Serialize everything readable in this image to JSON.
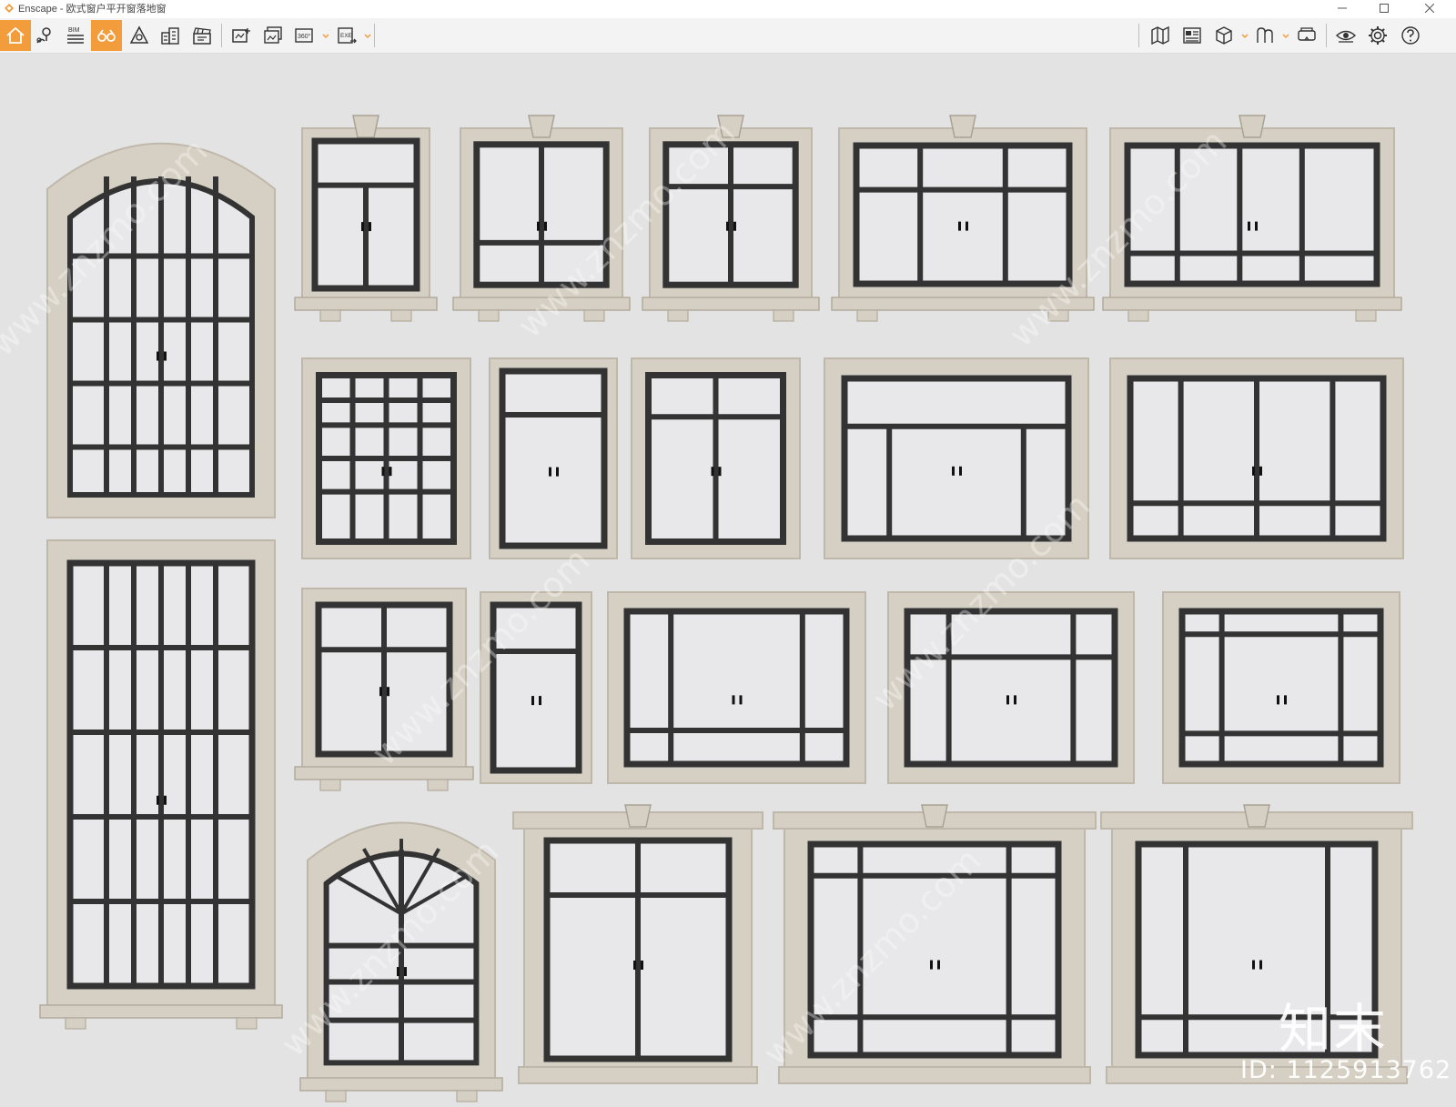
{
  "window": {
    "app_name": "Enscape",
    "separator": " - ",
    "document_name": "欧式窗户平开窗落地窗"
  },
  "toolbar": {
    "left_tools": [
      {
        "name": "home-icon",
        "active": true
      },
      {
        "name": "location-pin-icon",
        "active": false
      },
      {
        "name": "bim-icon",
        "label": "BIM",
        "active": false
      },
      {
        "name": "binoculars-icon",
        "active": true
      },
      {
        "name": "light-view-icon",
        "active": false
      },
      {
        "name": "buildings-icon",
        "active": false
      },
      {
        "name": "clapperboard-icon",
        "active": false
      },
      {
        "name": "screenshot-icon",
        "active": false
      },
      {
        "name": "batch-render-icon",
        "active": false
      },
      {
        "name": "panorama-360-icon",
        "label": "360°",
        "active": false
      },
      {
        "name": "export-exe-icon",
        "label": "EXE",
        "active": false
      }
    ],
    "right_tools": [
      {
        "name": "map-icon"
      },
      {
        "name": "asset-library-icon"
      },
      {
        "name": "cube-view-icon"
      },
      {
        "name": "material-icon"
      },
      {
        "name": "vr-headset-icon"
      },
      {
        "name": "visual-settings-icon"
      },
      {
        "name": "settings-gear-icon"
      },
      {
        "name": "help-icon"
      }
    ]
  },
  "watermark": {
    "brand": "知末",
    "id": "ID: 1125913762",
    "diagonal": "www.znzmo.com"
  },
  "colors": {
    "accent": "#f39c3c",
    "wall": "#e4e3e4",
    "stone": "#d6d0c4",
    "frame": "#333333",
    "glass": "#e8e7e9"
  }
}
